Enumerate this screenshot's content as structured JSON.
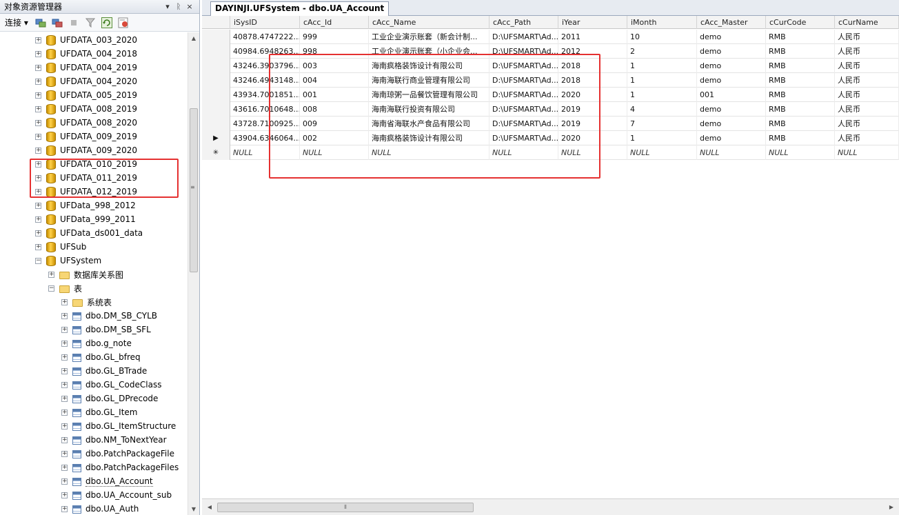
{
  "explorer": {
    "title": "对象资源管理器",
    "header_buttons": [
      "▾",
      "ᚱ",
      "×"
    ],
    "toolbar": {
      "connect_label": "连接",
      "connect_arrow": "▾",
      "icons": [
        "connect-icon",
        "disconnect-icon",
        "stop-icon",
        "filter-icon",
        "refresh-icon",
        "schema-icon"
      ]
    },
    "tree": [
      {
        "label": "UFDATA_003_2020",
        "type": "db",
        "indent": 0,
        "expander": "+"
      },
      {
        "label": "UFDATA_004_2018",
        "type": "db",
        "indent": 0,
        "expander": "+"
      },
      {
        "label": "UFDATA_004_2019",
        "type": "db",
        "indent": 0,
        "expander": "+"
      },
      {
        "label": "UFDATA_004_2020",
        "type": "db",
        "indent": 0,
        "expander": "+"
      },
      {
        "label": "UFDATA_005_2019",
        "type": "db",
        "indent": 0,
        "expander": "+"
      },
      {
        "label": "UFDATA_008_2019",
        "type": "db",
        "indent": 0,
        "expander": "+"
      },
      {
        "label": "UFDATA_008_2020",
        "type": "db",
        "indent": 0,
        "expander": "+"
      },
      {
        "label": "UFDATA_009_2019",
        "type": "db",
        "indent": 0,
        "expander": "+"
      },
      {
        "label": "UFDATA_009_2020",
        "type": "db",
        "indent": 0,
        "expander": "+"
      },
      {
        "label": "UFDATA_010_2019",
        "type": "db",
        "indent": 0,
        "expander": "+"
      },
      {
        "label": "UFDATA_011_2019",
        "type": "db",
        "indent": 0,
        "expander": "+"
      },
      {
        "label": "UFDATA_012_2019",
        "type": "db",
        "indent": 0,
        "expander": "+"
      },
      {
        "label": "UFData_998_2012",
        "type": "db",
        "indent": 0,
        "expander": "+"
      },
      {
        "label": "UFData_999_2011",
        "type": "db",
        "indent": 0,
        "expander": "+"
      },
      {
        "label": "UFData_ds001_data",
        "type": "db",
        "indent": 0,
        "expander": "+"
      },
      {
        "label": "UFSub",
        "type": "db",
        "indent": 0,
        "expander": "+"
      },
      {
        "label": "UFSystem",
        "type": "db",
        "indent": 0,
        "expander": "−"
      },
      {
        "label": "数据库关系图",
        "type": "folder",
        "indent": 1,
        "expander": "+"
      },
      {
        "label": "表",
        "type": "folder",
        "indent": 1,
        "expander": "−"
      },
      {
        "label": "系统表",
        "type": "folder",
        "indent": 2,
        "expander": "+"
      },
      {
        "label": "dbo.DM_SB_CYLB",
        "type": "table",
        "indent": 2,
        "expander": "+"
      },
      {
        "label": "dbo.DM_SB_SFL",
        "type": "table",
        "indent": 2,
        "expander": "+"
      },
      {
        "label": "dbo.g_note",
        "type": "table",
        "indent": 2,
        "expander": "+"
      },
      {
        "label": "dbo.GL_bfreq",
        "type": "table",
        "indent": 2,
        "expander": "+"
      },
      {
        "label": "dbo.GL_BTrade",
        "type": "table",
        "indent": 2,
        "expander": "+"
      },
      {
        "label": "dbo.GL_CodeClass",
        "type": "table",
        "indent": 2,
        "expander": "+"
      },
      {
        "label": "dbo.GL_DPrecode",
        "type": "table",
        "indent": 2,
        "expander": "+"
      },
      {
        "label": "dbo.GL_Item",
        "type": "table",
        "indent": 2,
        "expander": "+"
      },
      {
        "label": "dbo.GL_ItemStructure",
        "type": "table",
        "indent": 2,
        "expander": "+"
      },
      {
        "label": "dbo.NM_ToNextYear",
        "type": "table",
        "indent": 2,
        "expander": "+"
      },
      {
        "label": "dbo.PatchPackageFile",
        "type": "table",
        "indent": 2,
        "expander": "+"
      },
      {
        "label": "dbo.PatchPackageFiles",
        "type": "table",
        "indent": 2,
        "expander": "+"
      },
      {
        "label": "dbo.UA_Account",
        "type": "table",
        "indent": 2,
        "expander": "+",
        "selected": true
      },
      {
        "label": "dbo.UA_Account_sub",
        "type": "table",
        "indent": 2,
        "expander": "+"
      },
      {
        "label": "dbo.UA_Auth",
        "type": "table",
        "indent": 2,
        "expander": "+"
      }
    ],
    "scroll_grip": "≡"
  },
  "document": {
    "tab_title": "DAYINJI.UFSystem - dbo.UA_Account",
    "columns": [
      "iSysID",
      "cAcc_Id",
      "cAcc_Name",
      "cAcc_Path",
      "iYear",
      "iMonth",
      "cAcc_Master",
      "cCurCode",
      "cCurName"
    ],
    "rows": [
      {
        "marker": "",
        "cells": [
          "40878.4747222...",
          "999",
          "工业企业演示账套（新会计制...",
          "D:\\UFSMART\\Ad...",
          "2011",
          "10",
          "demo",
          "RMB",
          "人民币"
        ]
      },
      {
        "marker": "",
        "cells": [
          "40984.6948263...",
          "998",
          "工业企业演示账套（小企业会...",
          "D:\\UFSMART\\Ad...",
          "2012",
          "2",
          "demo",
          "RMB",
          "人民币"
        ]
      },
      {
        "marker": "",
        "cells": [
          "43246.3903796...",
          "003",
          "海南疯格装饰设计有限公司",
          "D:\\UFSMART\\Ad...",
          "2018",
          "1",
          "demo",
          "RMB",
          "人民币"
        ]
      },
      {
        "marker": "",
        "cells": [
          "43246.4943148...",
          "004",
          "海南海联行商业管理有限公司",
          "D:\\UFSMART\\Ad...",
          "2018",
          "1",
          "demo",
          "RMB",
          "人民币"
        ]
      },
      {
        "marker": "",
        "cells": [
          "43934.7001851...",
          "001",
          "海南琼粥一品餐饮管理有限公司",
          "D:\\UFSMART\\Ad...",
          "2020",
          "1",
          "001",
          "RMB",
          "人民币"
        ]
      },
      {
        "marker": "",
        "cells": [
          "43616.7010648...",
          "008",
          "海南海联行投资有限公司",
          "D:\\UFSMART\\Ad...",
          "2019",
          "4",
          "demo",
          "RMB",
          "人民币"
        ]
      },
      {
        "marker": "",
        "cells": [
          "43728.7100925...",
          "009",
          "海南省海联水产食品有限公司",
          "D:\\UFSMART\\Ad...",
          "2019",
          "7",
          "demo",
          "RMB",
          "人民币"
        ]
      },
      {
        "marker": "▶",
        "cells": [
          "43904.6346064...",
          "002",
          "海南疯格装饰设计有限公司",
          "D:\\UFSMART\\Ad...",
          "2020",
          "1",
          "demo",
          "RMB",
          "人民币"
        ]
      },
      {
        "marker": "✳",
        "cells": [
          "NULL",
          "NULL",
          "NULL",
          "NULL",
          "NULL",
          "NULL",
          "NULL",
          "NULL",
          "NULL"
        ],
        "is_new": true
      }
    ],
    "hscroll_grip": "⦀"
  },
  "colors": {
    "highlight": "#e53030",
    "header_bg": "#f3f3f3"
  }
}
